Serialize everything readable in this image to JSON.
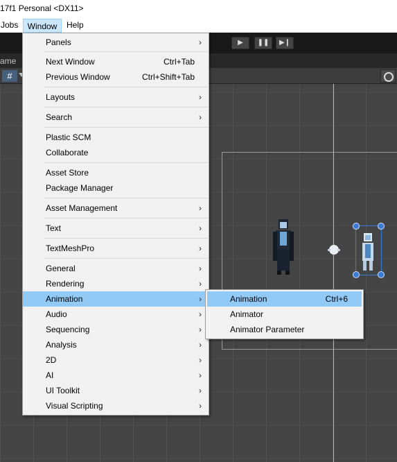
{
  "titlebar": {
    "text": "17f1 Personal <DX11>"
  },
  "menubar": {
    "items": [
      "Jobs",
      "Window",
      "Help"
    ]
  },
  "tabstrip": {
    "text": "ame"
  },
  "window_menu": {
    "items": [
      {
        "label": "Panels",
        "submenu": true
      },
      {
        "label": "Next Window",
        "shortcut": "Ctrl+Tab"
      },
      {
        "label": "Previous Window",
        "shortcut": "Ctrl+Shift+Tab"
      },
      {
        "label": "Layouts",
        "submenu": true
      },
      {
        "label": "Search",
        "submenu": true
      },
      {
        "label": "Plastic SCM"
      },
      {
        "label": "Collaborate"
      },
      {
        "label": "Asset Store"
      },
      {
        "label": "Package Manager"
      },
      {
        "label": "Asset Management",
        "submenu": true
      },
      {
        "label": "Text",
        "submenu": true
      },
      {
        "label": "TextMeshPro",
        "submenu": true
      },
      {
        "label": "General",
        "submenu": true
      },
      {
        "label": "Rendering",
        "submenu": true
      },
      {
        "label": "Animation",
        "submenu": true,
        "highlighted": true
      },
      {
        "label": "Audio",
        "submenu": true
      },
      {
        "label": "Sequencing",
        "submenu": true
      },
      {
        "label": "Analysis",
        "submenu": true
      },
      {
        "label": "2D",
        "submenu": true
      },
      {
        "label": "AI",
        "submenu": true
      },
      {
        "label": "UI Toolkit",
        "submenu": true
      },
      {
        "label": "Visual Scripting",
        "submenu": true
      }
    ]
  },
  "animation_submenu": {
    "items": [
      {
        "label": "Animation",
        "shortcut": "Ctrl+6",
        "highlighted": true
      },
      {
        "label": "Animator"
      },
      {
        "label": "Animator Parameter"
      }
    ]
  },
  "colors": {
    "highlight": "#91c9f7",
    "menu_bg": "#f2f2f2",
    "scene_bg": "#444444",
    "toolbar_bg": "#191919",
    "selection_handle": "#3a7bd5"
  }
}
